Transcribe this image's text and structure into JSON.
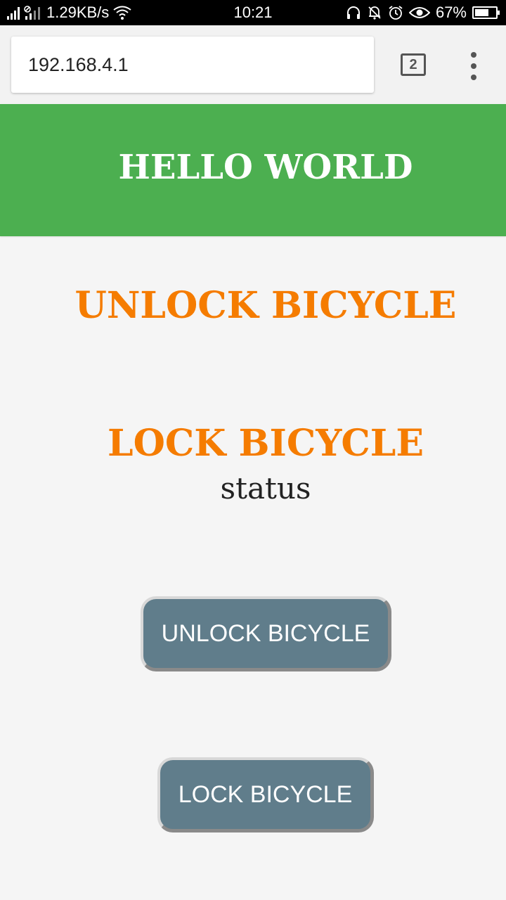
{
  "status_bar": {
    "network_speed": "1.29KB/s",
    "time": "10:21",
    "battery_percent": "67%",
    "battery_level": 0.67,
    "icons": [
      "signal-icon",
      "signal-icon",
      "wifi-icon",
      "headphones-icon",
      "notifications-off-icon",
      "alarm-icon",
      "eye-icon",
      "battery-icon"
    ]
  },
  "browser": {
    "url": "192.168.4.1",
    "tab_count": "2",
    "menu_icon": "more-vert-icon"
  },
  "page": {
    "header_title": "HELLO WORLD",
    "unlock_heading": "UNLOCK BICYCLE",
    "lock_heading": "LOCK BICYCLE",
    "status": "status",
    "unlock_button": "UNLOCK BICYCLE",
    "lock_button": "LOCK BICYCLE"
  },
  "colors": {
    "header_bg": "#4caf50",
    "heading_orange": "#f57c00",
    "button_bg": "#607d8b",
    "page_bg": "#f5f5f5"
  }
}
